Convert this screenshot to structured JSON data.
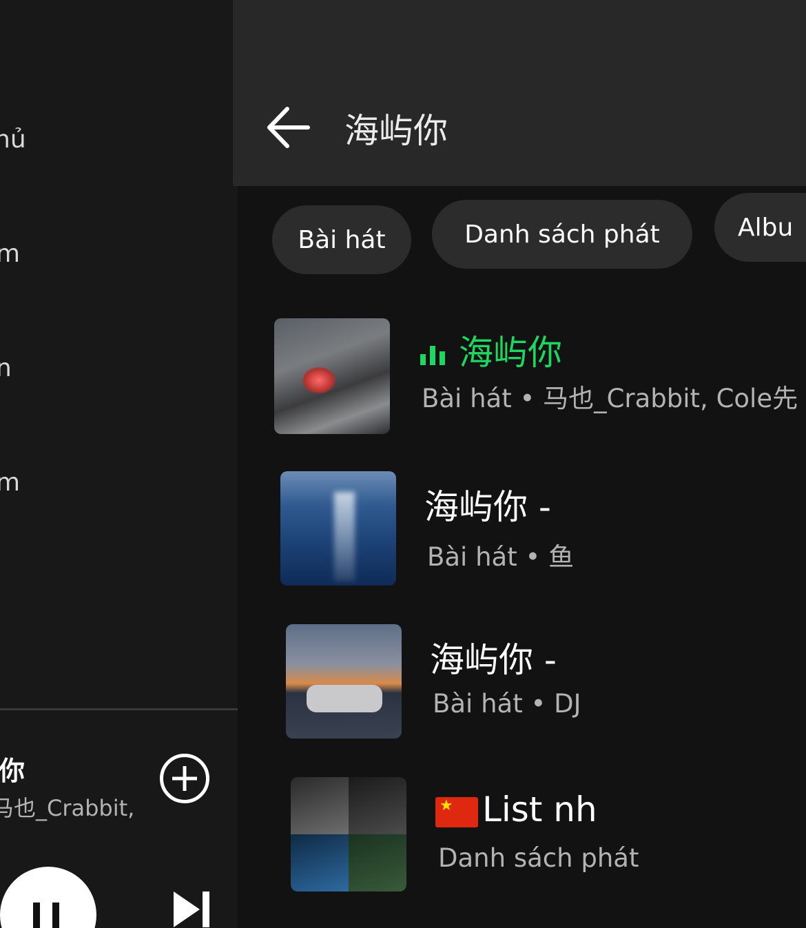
{
  "sidebar": {
    "items": [
      {
        "label": "hủ"
      },
      {
        "label": "m"
      },
      {
        "label": "n"
      },
      {
        "label": "m"
      }
    ]
  },
  "mini_player": {
    "title": "屿你",
    "artist": "马也_Crabbit,"
  },
  "header": {
    "query": "海屿你"
  },
  "filters": [
    {
      "label": "Bài hát"
    },
    {
      "label": "Danh sách phát"
    },
    {
      "label": "Albu"
    }
  ],
  "results": [
    {
      "title": "海屿你",
      "subtitle": "Bài hát • 马也_Crabbit, Cole先",
      "playing": true
    },
    {
      "title": "海屿你 -",
      "subtitle": "Bài hát • 鱼"
    },
    {
      "title": "海屿你 - ",
      "subtitle": "Bài hát • DJ"
    },
    {
      "title": "List nh",
      "subtitle": "Danh sách phát"
    }
  ],
  "colors": {
    "accent": "#1ed760",
    "background": "#121212",
    "header": "#282828",
    "chip": "#2c2c2c"
  }
}
